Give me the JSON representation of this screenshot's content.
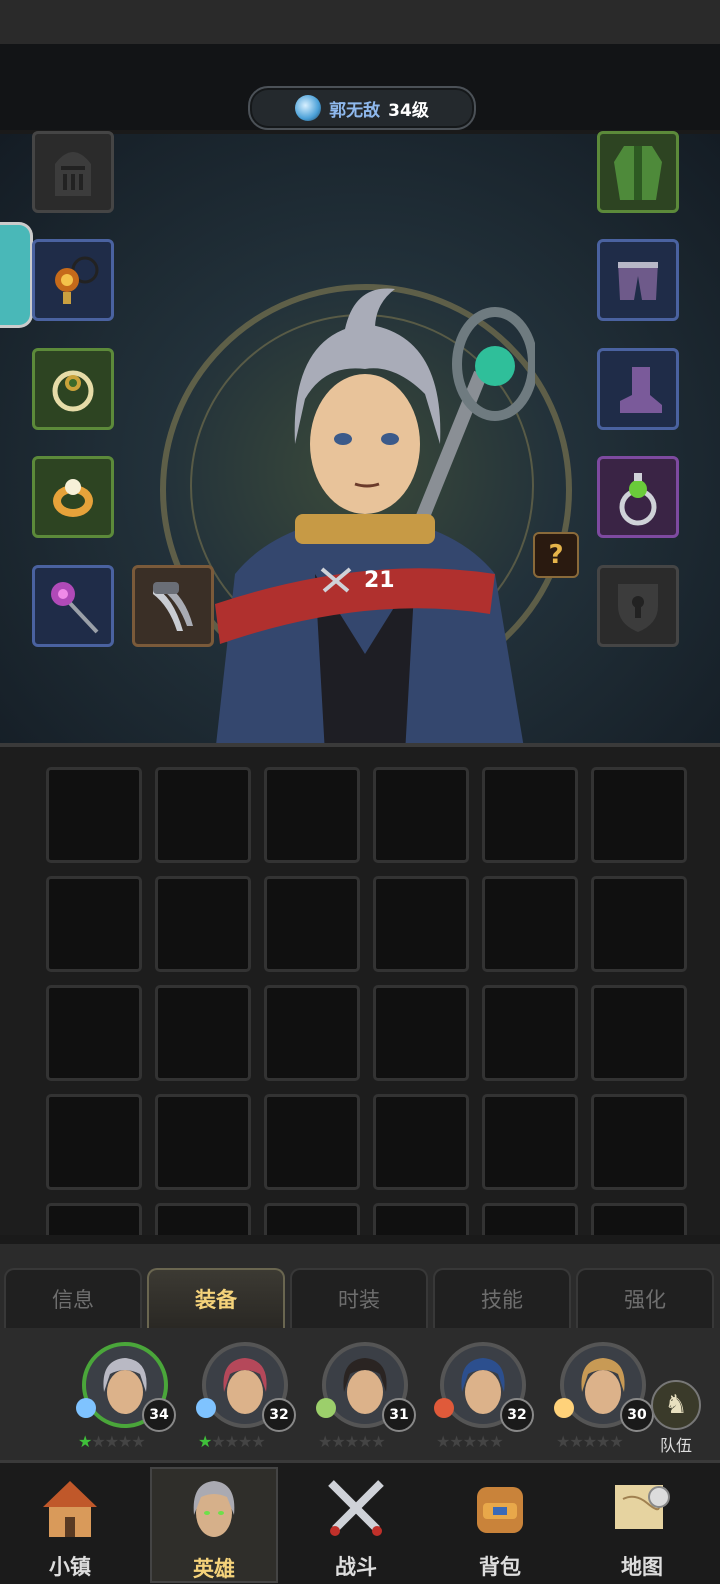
{
  "header": {
    "hero_name": "郭无敌",
    "hero_level": "34级"
  },
  "stats": {
    "power": "21"
  },
  "equipment": {
    "left": [
      {
        "name": "helmet-slot-icon",
        "rarity": "empty"
      },
      {
        "name": "necklace-icon",
        "rarity": "blue"
      },
      {
        "name": "wreath-amulet-icon",
        "rarity": "green"
      },
      {
        "name": "gold-ring-icon",
        "rarity": "green"
      },
      {
        "name": "magic-staff-icon",
        "rarity": "blue"
      }
    ],
    "right": [
      {
        "name": "green-robe-icon",
        "rarity": "green"
      },
      {
        "name": "pants-icon",
        "rarity": "blue"
      },
      {
        "name": "boots-icon",
        "rarity": "blue"
      },
      {
        "name": "potion-ring-icon",
        "rarity": "purple"
      },
      {
        "name": "shield-slot-icon",
        "rarity": "empty"
      }
    ],
    "extra": {
      "name": "claw-weapon-icon",
      "rarity": "brown"
    }
  },
  "tabs": [
    {
      "label": "信息",
      "active": false
    },
    {
      "label": "装备",
      "active": true
    },
    {
      "label": "时装",
      "active": false
    },
    {
      "label": "技能",
      "active": false
    },
    {
      "label": "强化",
      "active": false
    }
  ],
  "party": [
    {
      "level": "34",
      "selected": true,
      "stars_on": 1,
      "hair": "#b9b9c4",
      "badge_color": "#7fc3ff"
    },
    {
      "level": "32",
      "selected": false,
      "stars_on": 1,
      "hair": "#b5485a",
      "badge_color": "#7fc3ff"
    },
    {
      "level": "31",
      "selected": false,
      "stars_on": 0,
      "hair": "#2a2422",
      "badge_color": "#9ccf6b"
    },
    {
      "level": "32",
      "selected": false,
      "stars_on": 0,
      "hair": "#2c4f8e",
      "badge_color": "#e05a3a"
    },
    {
      "level": "30",
      "selected": false,
      "stars_on": 0,
      "hair": "#c89a55",
      "badge_color": "#ffd27a"
    }
  ],
  "team_button": {
    "label": "队伍"
  },
  "bottom_nav": [
    {
      "label": "小镇",
      "icon": "town-icon",
      "active": false
    },
    {
      "label": "英雄",
      "icon": "hero-icon",
      "active": true
    },
    {
      "label": "战斗",
      "icon": "battle-swords-icon",
      "active": false
    },
    {
      "label": "背包",
      "icon": "backpack-icon",
      "active": false
    },
    {
      "label": "地图",
      "icon": "map-icon",
      "active": false
    }
  ],
  "inventory": {
    "slot_count": 30
  }
}
